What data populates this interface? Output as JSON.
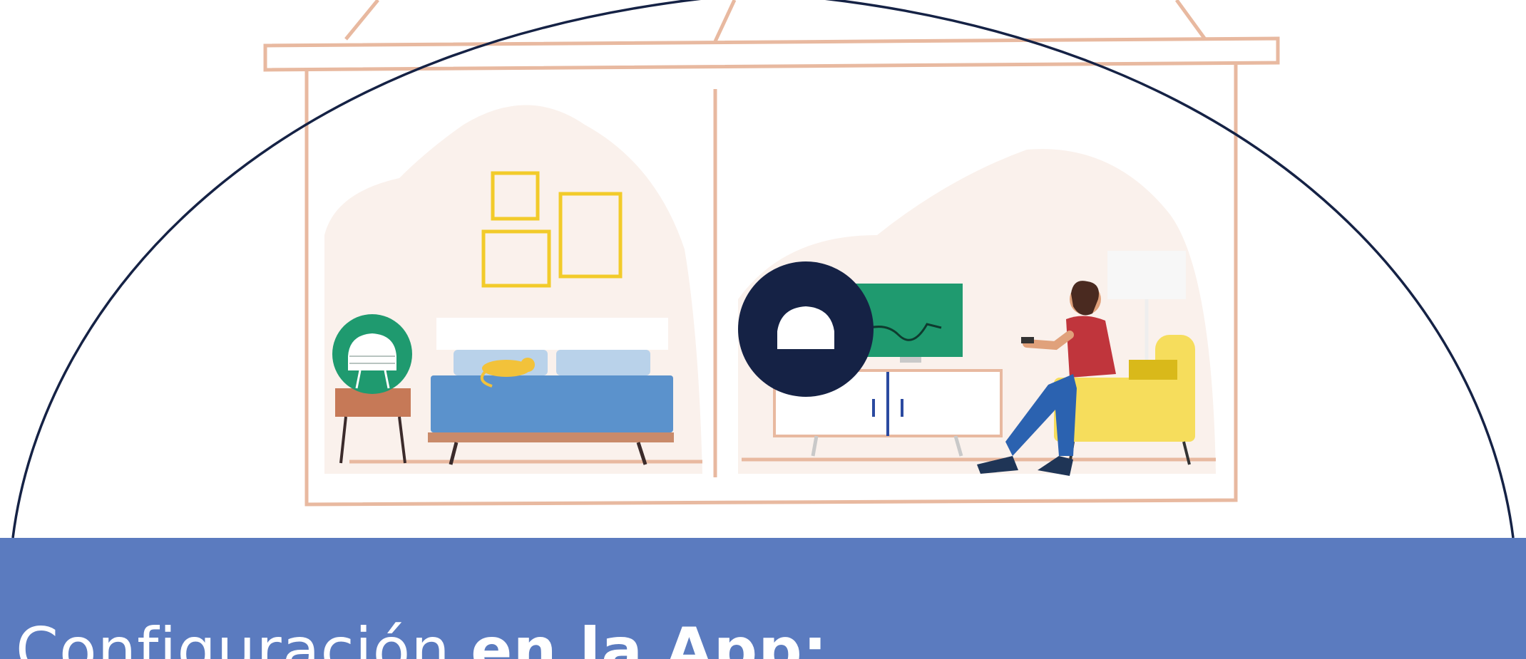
{
  "colors": {
    "banner": "#5b7bbf",
    "house_outline": "#e8b9a0",
    "dome_outline": "#152245",
    "room_blob": "#faf1ec",
    "frames": "#f2cb2a",
    "bed": "#5b92cc",
    "pillow": "#b9d2ea",
    "cat": "#f2c23a",
    "mesh_node_green": "#1f9a6f",
    "mesh_node_navy": "#152245",
    "tv_screen": "#1f9a6f",
    "armchair": "#f6dd5c",
    "shirt": "#c0353c",
    "jeans": "#2b62b0"
  },
  "icons": {
    "left_device": "mesh-router-node-icon",
    "right_device": "mesh-router-node-icon"
  },
  "banner": {
    "title_regular": "Configuración ",
    "title_bold": "en la App:"
  }
}
